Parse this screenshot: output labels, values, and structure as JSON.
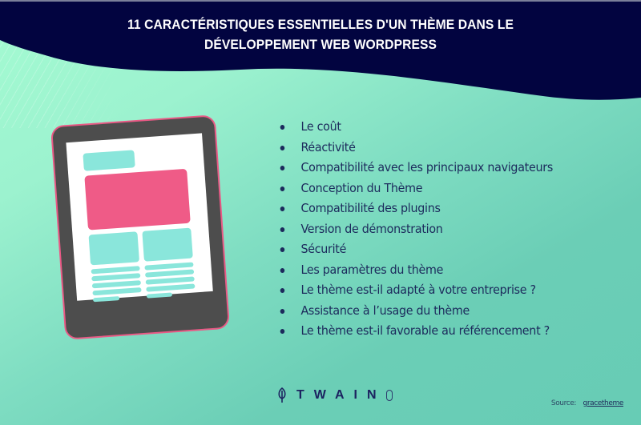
{
  "header": {
    "title_line1": "11 CARACTÉRISTIQUES ESSENTIELLES D'UN THÈME DANS LE",
    "title_line2": "DÉVELOPPEMENT WEB WORDPRESS"
  },
  "illustration": {
    "icon": "tablet-webpage-mockup-icon"
  },
  "features": [
    "Le coût",
    "Réactivité",
    "Compatibilité avec les principaux navigateurs",
    "Conception du Thème",
    "Compatibilité des plugins",
    "Version de démonstration",
    "Sécurité",
    "Les paramètres du thème",
    "Le thème est-il adapté à votre entreprise ?",
    "Assistance à l’usage du thème",
    "Le thème est-il favorable au référencement ?"
  ],
  "footer": {
    "logo_text": "TWAIN",
    "logo_icon": "leaf-icon",
    "source_label": "Source:",
    "source_link": "gracetheme"
  },
  "colors": {
    "navy": "#020440",
    "mint_light": "#a4fbd2",
    "teal": "#67ccb5",
    "pink": "#ef5b87",
    "screen_teal": "#8ae6db",
    "device_gray": "#4d4d4d",
    "text_navy": "#1c2a5c"
  }
}
